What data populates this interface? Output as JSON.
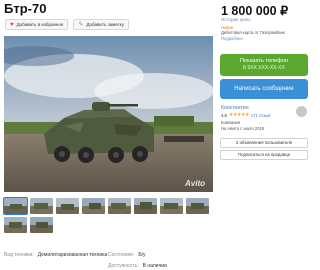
{
  "listing": {
    "title": "Бтр-70",
    "price": "1 800 000 ₽",
    "price_history_link": "История цены",
    "deal": {
      "new_label": "Новое",
      "text": "Дебетовая карта от Газпромбанк",
      "more": "Подробнее"
    }
  },
  "actions": {
    "favorite": {
      "label": "Добавить в избранное",
      "icon": "heart-icon"
    },
    "note": {
      "label": "Добавить заметку",
      "icon": "note-icon"
    }
  },
  "contact": {
    "phone_label": "Показать телефон",
    "phone_masked": "8 9XX XXX-XX-XX",
    "message_label": "Написать сообщение"
  },
  "seller": {
    "name": "Константин",
    "rating": "4,9",
    "stars": "★★★★★",
    "reviews": "171 отзыв",
    "type": "Компания",
    "since": "На Авито с июля 2019"
  },
  "seller_actions": {
    "other_listings": "2 объявления пользователя",
    "subscribe": "Подписаться на продавца"
  },
  "gallery": {
    "watermark": "Avito",
    "thumb_count": 10,
    "selected_index": 0
  },
  "specs": [
    {
      "label": "Вид техники:",
      "value": "Демилитаризованная техника"
    },
    {
      "label": "Состояние:",
      "value": "Б/у"
    },
    {
      "label": "Доступность:",
      "value": "В наличии"
    }
  ],
  "colors": {
    "phone_button": "#5aa82d",
    "message_button": "#3a90d6",
    "link": "#3a78c0",
    "accent_new": "#e07a1f",
    "star": "#ffa21a"
  }
}
